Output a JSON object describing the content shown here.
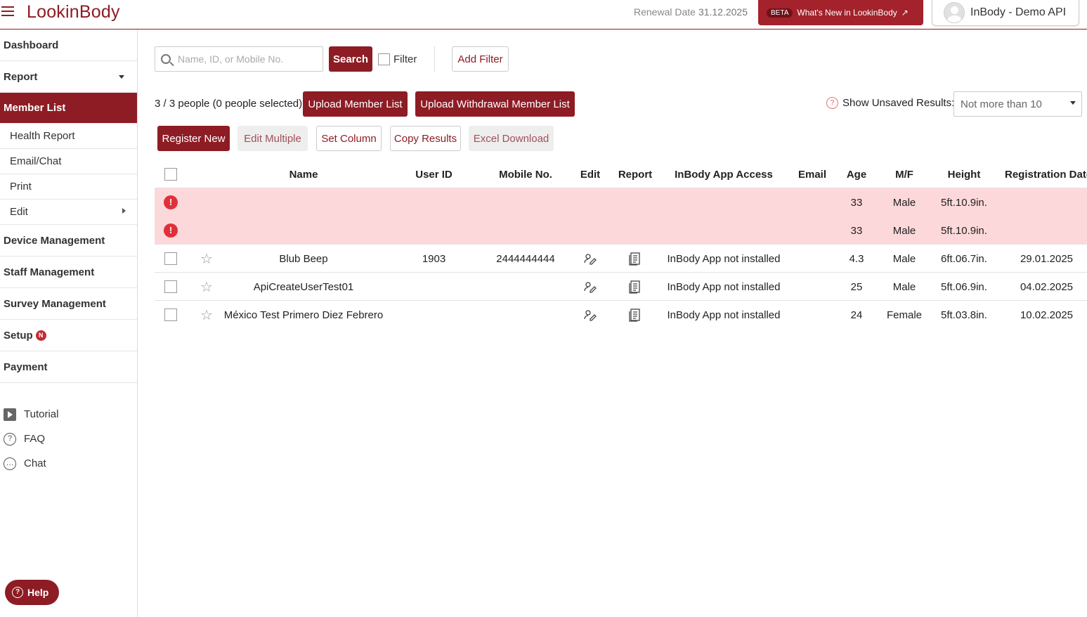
{
  "header": {
    "logo": "LookinBody",
    "renewal_label": "Renewal Date",
    "renewal_date": "31.12.2025",
    "beta": "BETA",
    "whats_new": "What's New in LookinBody",
    "account": "InBody - Demo API"
  },
  "sidebar": {
    "items": [
      "Dashboard",
      "Report",
      "Member List",
      "Device Management",
      "Staff Management",
      "Survey Management",
      "Setup",
      "Payment"
    ],
    "sub_items": [
      "Health Report",
      "Email/Chat",
      "Print",
      "Edit"
    ],
    "setup_badge": "N",
    "help_links": [
      "Tutorial",
      "FAQ",
      "Chat"
    ],
    "help_button": "Help"
  },
  "toolbar": {
    "search_placeholder": "Name, ID, or Mobile No.",
    "search_button": "Search",
    "filter_label": "Filter",
    "add_filter": "Add Filter",
    "count_text": "3 / 3 people (0 people selected)",
    "upload_member_list": "Upload Member List",
    "upload_withdrawal": "Upload Withdrawal Member List",
    "show_unsaved_label": "Show Unsaved Results:",
    "show_unsaved_value": "Not more than 10",
    "register_new": "Register New",
    "edit_multiple": "Edit Multiple",
    "set_column": "Set Column",
    "copy_results": "Copy Results",
    "excel_download": "Excel Download"
  },
  "table": {
    "headers": [
      "Name",
      "User ID",
      "Mobile No.",
      "Edit",
      "Report",
      "InBody App Access",
      "Email",
      "Age",
      "M/F",
      "Height",
      "Registration Date"
    ],
    "error_rows": [
      {
        "age": "33",
        "gender": "Male",
        "height": "5ft.10.9in."
      },
      {
        "age": "33",
        "gender": "Male",
        "height": "5ft.10.9in."
      }
    ],
    "rows": [
      {
        "name": "Blub Beep",
        "user_id": "1903",
        "mobile": "2444444444",
        "app_access": "InBody App not installed",
        "email": "",
        "age": "4.3",
        "gender": "Male",
        "height": "6ft.06.7in.",
        "reg_date": "29.01.2025"
      },
      {
        "name": "ApiCreateUserTest01",
        "user_id": "",
        "mobile": "",
        "app_access": "InBody App not installed",
        "email": "",
        "age": "25",
        "gender": "Male",
        "height": "5ft.06.9in.",
        "reg_date": "04.02.2025"
      },
      {
        "name": "México Test Primero Diez Febrero",
        "user_id": "",
        "mobile": "",
        "app_access": "InBody App not installed",
        "email": "",
        "age": "24",
        "gender": "Female",
        "height": "5ft.03.8in.",
        "reg_date": "10.02.2025"
      }
    ]
  }
}
